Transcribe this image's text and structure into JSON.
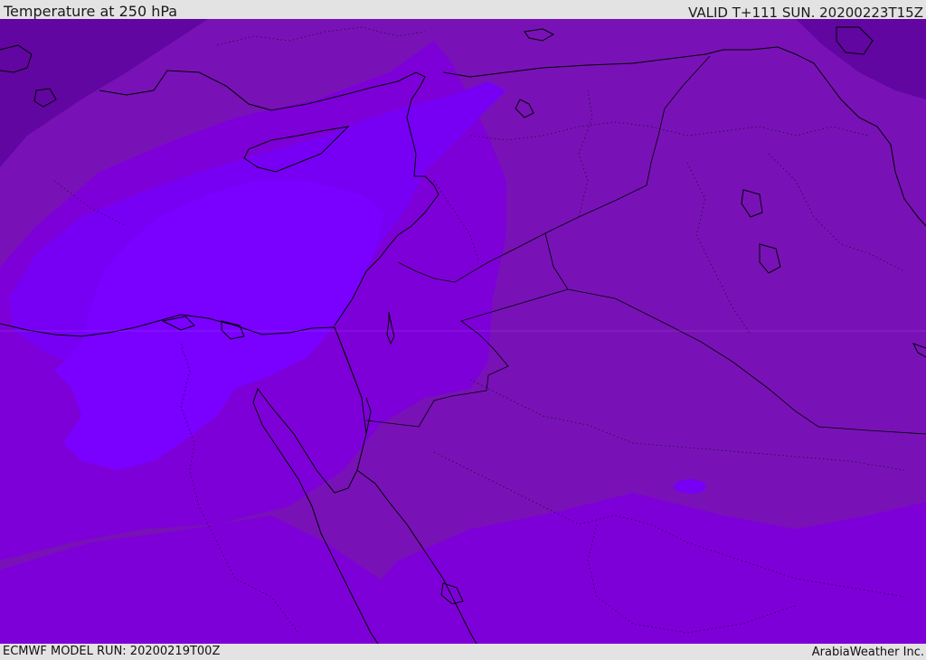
{
  "header": {
    "title": "Temperature at 250 hPa",
    "valid_time": "VALID T+111 SUN. 20200223T15Z"
  },
  "footer": {
    "model_run": "ECMWF MODEL RUN: 20200219T00Z",
    "credit": "ArabiaWeather Inc."
  },
  "map": {
    "colors": {
      "coldest": "#5a0094",
      "cold": "#6c0aa8",
      "cool": "#7a12b8",
      "mid": "#7e00d8",
      "warm": "#7700f4",
      "warmest": "#7a00ff",
      "coast": "#000000"
    }
  }
}
